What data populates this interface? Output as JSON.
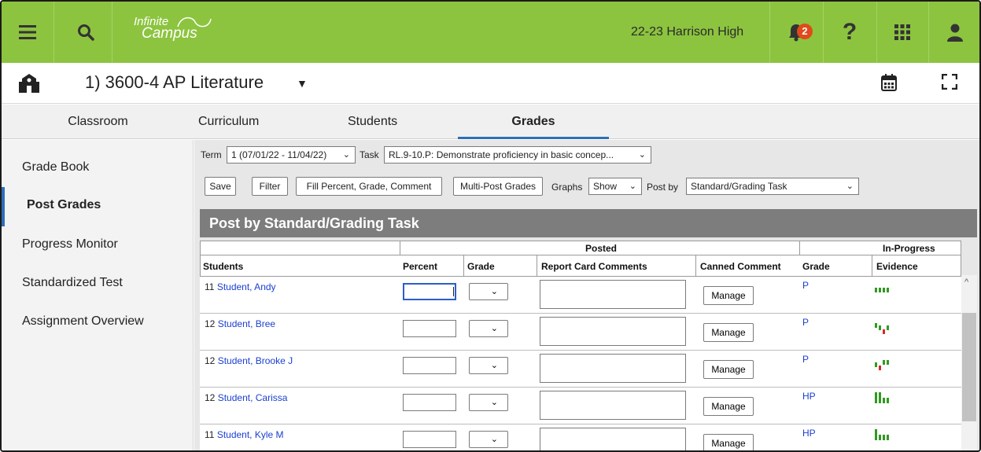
{
  "topbar": {
    "logo_line1": "Infinite",
    "logo_line2": "Campus",
    "school": "22-23 Harrison High",
    "notification_count": "2"
  },
  "course": {
    "title": "1) 3600-4 AP Literature"
  },
  "tabs": [
    {
      "label": "Classroom"
    },
    {
      "label": "Curriculum"
    },
    {
      "label": "Students"
    },
    {
      "label": "Grades",
      "active": true
    }
  ],
  "sidebar": {
    "items": [
      {
        "label": "Grade Book"
      },
      {
        "label": "Post Grades",
        "active": true
      },
      {
        "label": "Progress Monitor"
      },
      {
        "label": "Standardized Test"
      },
      {
        "label": "Assignment Overview"
      }
    ]
  },
  "filters": {
    "term_label": "Term",
    "term_value": "1 (07/01/22 - 11/04/22)",
    "task_label": "Task",
    "task_value": "RL.9-10.P: Demonstrate proficiency in basic concep...",
    "graphs_label": "Graphs",
    "graphs_value": "Show",
    "postby_label": "Post by",
    "postby_value": "Standard/Grading Task"
  },
  "toolbar": {
    "save": "Save",
    "filter": "Filter",
    "fill": "Fill Percent, Grade, Comment",
    "multipost": "Multi-Post Grades"
  },
  "panel": {
    "title": "Post by Standard/Grading Task",
    "group_posted": "Posted",
    "group_inprogress": "In-Progress",
    "col_students": "Students",
    "col_percent": "Percent",
    "col_grade": "Grade",
    "col_comments": "Report Card Comments",
    "col_canned": "Canned Comment",
    "col_ip_grade": "Grade",
    "col_evidence": "Evidence",
    "manage_label": "Manage"
  },
  "students": [
    {
      "grade_level": "11",
      "name": "Student, Andy",
      "ip_grade": "P"
    },
    {
      "grade_level": "12",
      "name": "Student, Bree",
      "ip_grade": "P"
    },
    {
      "grade_level": "12",
      "name": "Student, Brooke J",
      "ip_grade": "P"
    },
    {
      "grade_level": "12",
      "name": "Student, Carissa",
      "ip_grade": "HP"
    },
    {
      "grade_level": "11",
      "name": "Student, Kyle M",
      "ip_grade": "HP"
    }
  ],
  "colors": {
    "brand_green": "#8cc43f",
    "link_blue": "#1a3fd0",
    "evidence_green": "#2e9b1e",
    "evidence_red": "#e0262a"
  }
}
